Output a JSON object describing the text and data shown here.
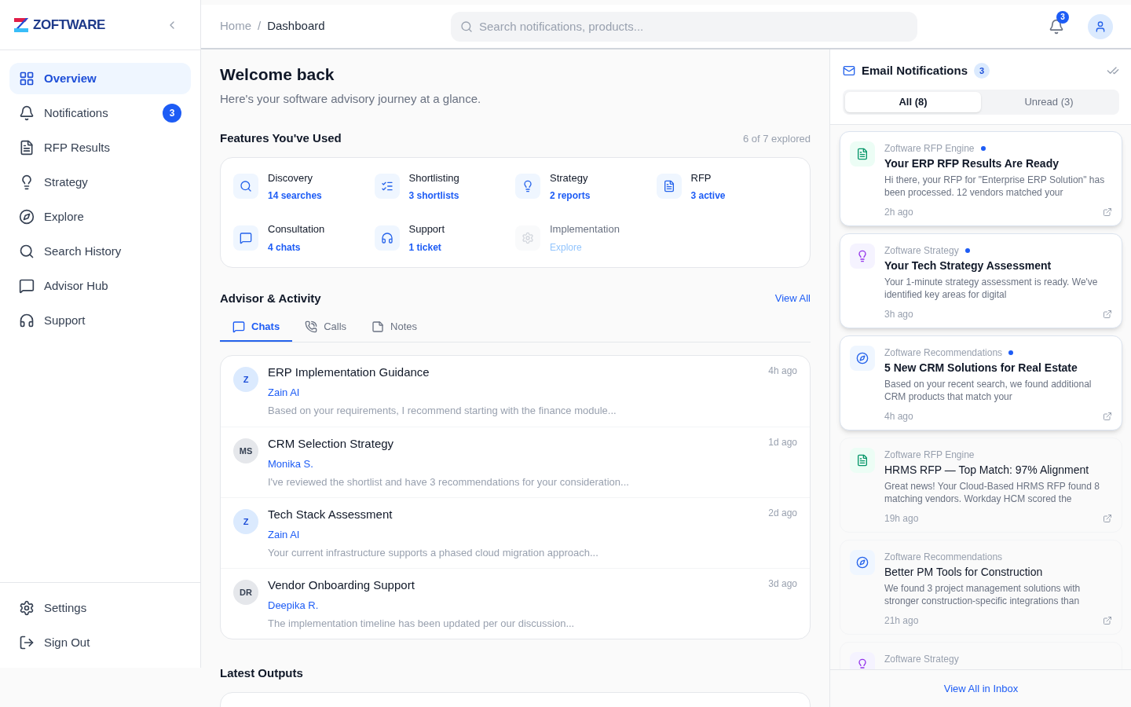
{
  "brand": {
    "name": "ZOFTWARE"
  },
  "sidebar": {
    "items": [
      {
        "label": "Overview",
        "kind": "grid",
        "selected": true
      },
      {
        "label": "Notifications",
        "kind": "bell",
        "selected": false,
        "badge": "3"
      },
      {
        "label": "RFP Results",
        "kind": "file",
        "selected": false
      },
      {
        "label": "Strategy",
        "kind": "bulb",
        "selected": false
      },
      {
        "label": "Explore",
        "kind": "compass",
        "selected": false
      },
      {
        "label": "Search History",
        "kind": "search",
        "selected": false
      },
      {
        "label": "Advisor Hub",
        "kind": "chat",
        "selected": false
      },
      {
        "label": "Support",
        "kind": "headset",
        "selected": false
      }
    ],
    "footer_items": [
      {
        "label": "Settings",
        "kind": "gear"
      },
      {
        "label": "Sign Out",
        "kind": "logout"
      }
    ]
  },
  "header": {
    "breadcrumb": [
      "Home",
      "Dashboard"
    ],
    "breadcrumb_separator": "/",
    "search": {
      "placeholder": "Search notifications, products..."
    },
    "bell_badge": "3"
  },
  "welcome": {
    "title": "Welcome back",
    "subtitle": "Here's your software advisory journey at a glance."
  },
  "features": {
    "title": "Features You've Used",
    "count": "6 of 7 explored",
    "items": [
      {
        "name": "Discovery",
        "stat": "14 searches",
        "kind": "search",
        "used": true
      },
      {
        "name": "Shortlisting",
        "stat": "3 shortlists",
        "kind": "checklist",
        "used": true
      },
      {
        "name": "Strategy",
        "stat": "2 reports",
        "kind": "bulb",
        "used": true
      },
      {
        "name": "RFP",
        "stat": "3 active",
        "kind": "file",
        "used": true
      },
      {
        "name": "Consultation",
        "stat": "4 chats",
        "kind": "chat",
        "used": true
      },
      {
        "name": "Support",
        "stat": "1 ticket",
        "kind": "headset",
        "used": true
      },
      {
        "name": "Implementation",
        "stat": "Explore",
        "kind": "gear",
        "used": false
      }
    ]
  },
  "activity": {
    "title": "Advisor & Activity",
    "view_all": "View All",
    "tabs": [
      {
        "label": "Chats",
        "kind": "chat",
        "selected": true
      },
      {
        "label": "Calls",
        "kind": "phone",
        "selected": false
      },
      {
        "label": "Notes",
        "kind": "note",
        "selected": false
      }
    ],
    "chats": [
      {
        "avatar": "Z",
        "kind": "ai",
        "title": "ERP Implementation Guidance",
        "advisor": "Zain AI",
        "preview": "Based on your requirements, I recommend starting with the finance module...",
        "time": "4h ago"
      },
      {
        "avatar": "MS",
        "kind": "person",
        "title": "CRM Selection Strategy",
        "advisor": "Monika S.",
        "preview": "I've reviewed the shortlist and have 3 recommendations for your consideration...",
        "time": "1d ago"
      },
      {
        "avatar": "Z",
        "kind": "ai",
        "title": "Tech Stack Assessment",
        "advisor": "Zain AI",
        "preview": "Your current infrastructure supports a phased cloud migration approach...",
        "time": "2d ago"
      },
      {
        "avatar": "DR",
        "kind": "person",
        "title": "Vendor Onboarding Support",
        "advisor": "Deepika R.",
        "preview": "The implementation timeline has been updated per our discussion...",
        "time": "3d ago"
      }
    ]
  },
  "latest_outputs": {
    "title": "Latest Outputs"
  },
  "email_panel": {
    "title": "Email Notifications",
    "badge": "3",
    "tabs": [
      {
        "label": "All (8)",
        "selected": true
      },
      {
        "label": "Unread (3)",
        "selected": false
      }
    ],
    "notifications": [
      {
        "kind": "rfp",
        "source": "Zoftware RFP Engine",
        "unread": true,
        "title": "Your ERP RFP Results Are Ready",
        "body": "Hi there, your RFP for \"Enterprise ERP Solution\" has been processed. 12 vendors matched your",
        "time": "2h ago"
      },
      {
        "kind": "strategy",
        "source": "Zoftware Strategy",
        "unread": true,
        "title": "Your Tech Strategy Assessment",
        "body": "Your 1-minute strategy assessment is ready. We've identified key areas for digital",
        "time": "3h ago"
      },
      {
        "kind": "recommendation",
        "source": "Zoftware Recommendations",
        "unread": true,
        "title": "5 New CRM Solutions for Real Estate",
        "body": "Based on your recent search, we found additional CRM products that match your",
        "time": "4h ago"
      },
      {
        "kind": "rfp",
        "source": "Zoftware RFP Engine",
        "unread": false,
        "title": "HRMS RFP — Top Match: 97% Alignment",
        "body": "Great news! Your Cloud-Based HRMS RFP found 8 matching vendors. Workday HCM scored the",
        "time": "19h ago"
      },
      {
        "kind": "recommendation",
        "source": "Zoftware Recommendations",
        "unread": false,
        "title": "Better PM Tools for Construction",
        "body": "We found 3 project management solutions with stronger construction-specific integrations than",
        "time": "21h ago"
      },
      {
        "kind": "strategy",
        "source": "Zoftware Strategy",
        "unread": false
      }
    ],
    "footer_link": "View All in Inbox"
  }
}
